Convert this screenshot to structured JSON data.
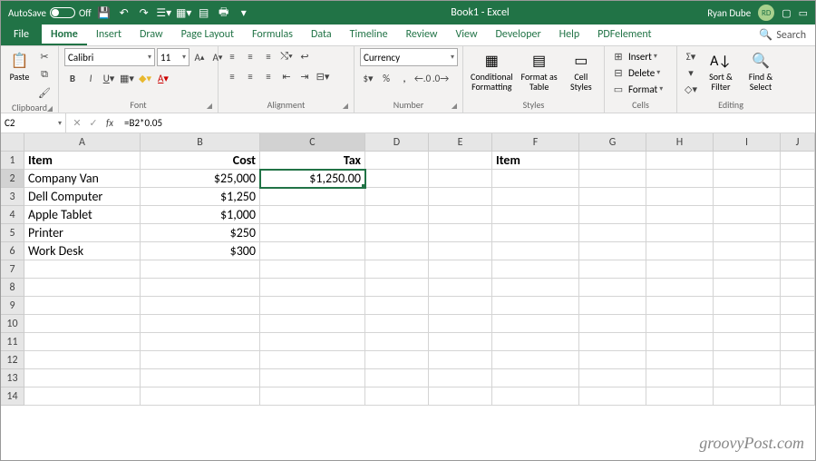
{
  "titlebar": {
    "autosave_label": "AutoSave",
    "autosave_state": "Off",
    "title": "Book1 - Excel",
    "user": "Ryan Dube",
    "user_initials": "RD"
  },
  "tabs": {
    "file": "File",
    "items": [
      "Home",
      "Insert",
      "Draw",
      "Page Layout",
      "Formulas",
      "Data",
      "Timeline",
      "Review",
      "View",
      "Developer",
      "Help",
      "PDFelement"
    ],
    "active": "Home",
    "search": "Search"
  },
  "ribbon": {
    "clipboard": {
      "label": "Clipboard",
      "paste": "Paste"
    },
    "font": {
      "label": "Font",
      "name": "Calibri",
      "size": "11"
    },
    "alignment": {
      "label": "Alignment"
    },
    "number": {
      "label": "Number",
      "format": "Currency"
    },
    "styles": {
      "label": "Styles",
      "cond": "Conditional Formatting",
      "table": "Format as Table",
      "cell": "Cell Styles"
    },
    "cells": {
      "label": "Cells",
      "insert": "Insert",
      "delete": "Delete",
      "format": "Format"
    },
    "editing": {
      "label": "Editing",
      "sort": "Sort & Filter",
      "find": "Find & Select"
    }
  },
  "formula_bar": {
    "cell_ref": "C2",
    "fx": "fx",
    "formula": "=B2*0.05"
  },
  "columns": [
    "A",
    "B",
    "C",
    "D",
    "E",
    "F",
    "G",
    "H",
    "I",
    "J"
  ],
  "active_col": "C",
  "active_row": 2,
  "sheet": {
    "rows": [
      {
        "n": 1,
        "A": "Item",
        "B": "Cost",
        "C": "Tax",
        "F": "Item",
        "bold": true
      },
      {
        "n": 2,
        "A": "Company Van",
        "B": "$25,000",
        "C": "$1,250.00"
      },
      {
        "n": 3,
        "A": "Dell Computer",
        "B": "$1,250"
      },
      {
        "n": 4,
        "A": "Apple Tablet",
        "B": "$1,000"
      },
      {
        "n": 5,
        "A": "Printer",
        "B": "$250"
      },
      {
        "n": 6,
        "A": "Work Desk",
        "B": "$300"
      },
      {
        "n": 7
      },
      {
        "n": 8
      },
      {
        "n": 9
      },
      {
        "n": 10
      },
      {
        "n": 11
      },
      {
        "n": 12
      },
      {
        "n": 13
      },
      {
        "n": 14
      }
    ]
  },
  "watermark": "groovyPost.com"
}
